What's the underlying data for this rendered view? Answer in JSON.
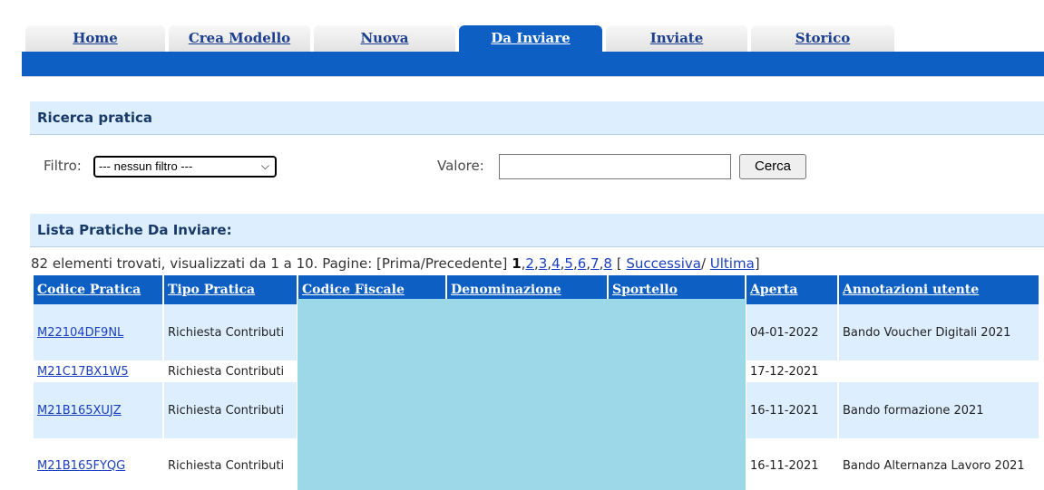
{
  "tabs": [
    {
      "label": "Home",
      "active": false
    },
    {
      "label": "Crea Modello",
      "active": false
    },
    {
      "label": "Nuova",
      "active": false
    },
    {
      "label": "Da Inviare",
      "active": true
    },
    {
      "label": "Inviate",
      "active": false
    },
    {
      "label": "Storico",
      "active": false
    }
  ],
  "search": {
    "title": "Ricerca pratica",
    "filter_label": "Filtro:",
    "filter_selected": "--- nessun filtro ---",
    "value_label": "Valore:",
    "value_input": "",
    "button_label": "Cerca"
  },
  "list": {
    "title": "Lista Pratiche Da Inviare:",
    "summary": "82 elementi trovati, visualizzati da 1 a 10. Pagine: [Prima/Precedente]",
    "current_page": "1",
    "pages": [
      "2",
      "3",
      "4",
      "5",
      "6",
      "7",
      "8"
    ],
    "next_label": "Successiva",
    "last_label": "Ultima"
  },
  "table": {
    "columns": [
      "Codice Pratica",
      "Tipo Pratica",
      "Codice Fiscale",
      "Denominazione",
      "Sportello",
      "Aperta",
      "Annotazioni utente"
    ],
    "rows": [
      {
        "codice": "M22104DF9NL",
        "tipo": "Richiesta Contributi",
        "aperta": "04-01-2022",
        "note": "Bando Voucher Digitali 2021"
      },
      {
        "codice": "M21C17BX1W5",
        "tipo": "Richiesta Contributi",
        "aperta": "17-12-2021",
        "note": ""
      },
      {
        "codice": "M21B165XUJZ",
        "tipo": "Richiesta Contributi",
        "aperta": "16-11-2021",
        "note": "Bando formazione 2021"
      },
      {
        "codice": "M21B165FYQG",
        "tipo": "Richiesta Contributi",
        "aperta": "16-11-2021",
        "note": "Bando Alternanza Lavoro 2021"
      }
    ]
  },
  "colors": {
    "accent": "#0d5fc4",
    "section_bg": "#ddeeff",
    "redaction": "#9dd8e9"
  }
}
